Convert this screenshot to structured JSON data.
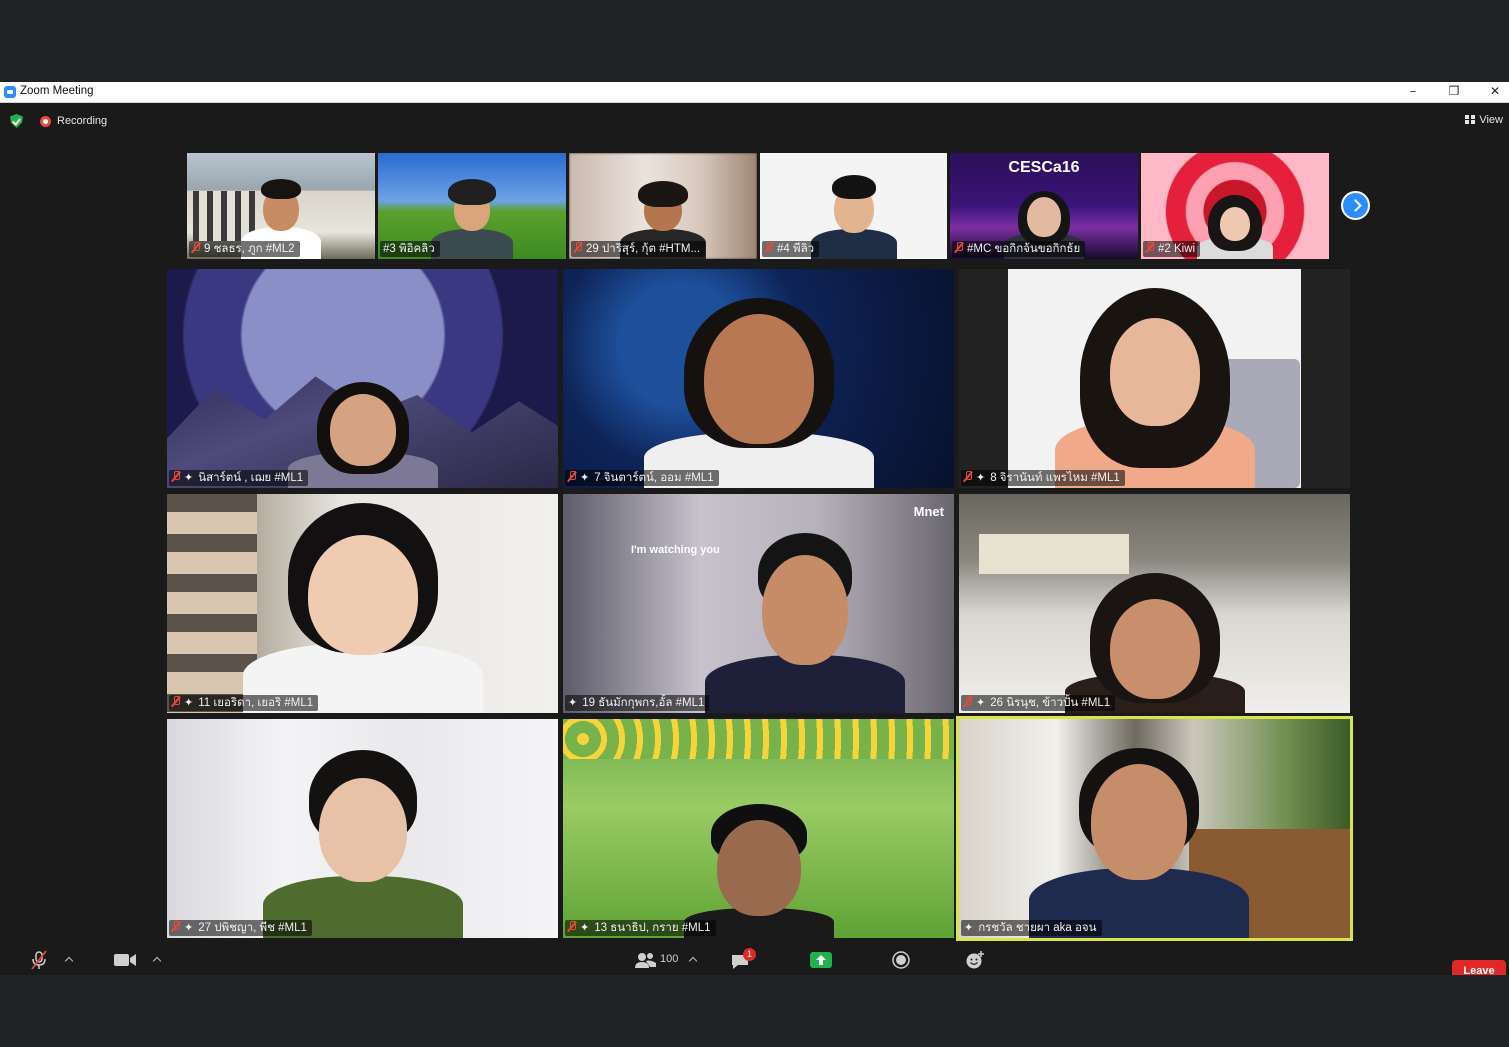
{
  "window": {
    "title": "Zoom Meeting",
    "minimize": "–",
    "restore": "❐",
    "close": "✕"
  },
  "topbar": {
    "recording_label": "Recording",
    "view_label": "View"
  },
  "strip": [
    {
      "name": "9 ชลธร, ภูก #ML2",
      "mic_muted": true
    },
    {
      "name": "#3 พิอิคลิว",
      "mic_muted": false
    },
    {
      "name": "29 ปาริสุร์, กุ้ต #HTM...",
      "mic_muted": true
    },
    {
      "name": "#4 พีลิว",
      "mic_muted": true
    },
    {
      "name": "#MC ขอกิกจ้นขอกิกธ้ย",
      "mic_muted": true,
      "banner": "CESCa16"
    },
    {
      "name": "#2 Kiwi",
      "mic_muted": true
    }
  ],
  "grid": [
    {
      "name": "นิสาร์ตน์ , เฌย #ML1",
      "mic_muted": true,
      "pinned": true
    },
    {
      "name": "7 จินตาร์ตน์, ออม #ML1",
      "mic_muted": true,
      "pinned": true
    },
    {
      "name": "8 จิรานันท์ แพรไหม #ML1",
      "mic_muted": true,
      "pinned": true
    },
    {
      "name": "11 เยอริดา, เยอริ #ML1",
      "mic_muted": true,
      "pinned": true
    },
    {
      "name": "19 ธันมักกุพกร,อั้ล #ML1",
      "mic_muted": false,
      "pinned": true,
      "overlay_text": "I'm watching you",
      "brand_text": "Mnet"
    },
    {
      "name": "26 นิรนุช, ข้าวปั้น #ML1",
      "mic_muted": true,
      "pinned": true
    },
    {
      "name": "27 ปพิชญา, พีช #ML1",
      "mic_muted": true,
      "pinned": true
    },
    {
      "name": "13 ธนาธิป, กราย #ML1",
      "mic_muted": true,
      "pinned": true
    },
    {
      "name": "กรชวัล ชายผา aka อจน",
      "mic_muted": false,
      "pinned": true,
      "active_speaker": true
    }
  ],
  "toolbar": {
    "participants_count": "100",
    "chat_badge": "1",
    "leave_label": "Leave"
  },
  "colors": {
    "active_speaker_border": "#d7e54a",
    "leave_red": "#e02828",
    "zoom_blue": "#2d8cff",
    "share_green": "#22b14c"
  }
}
